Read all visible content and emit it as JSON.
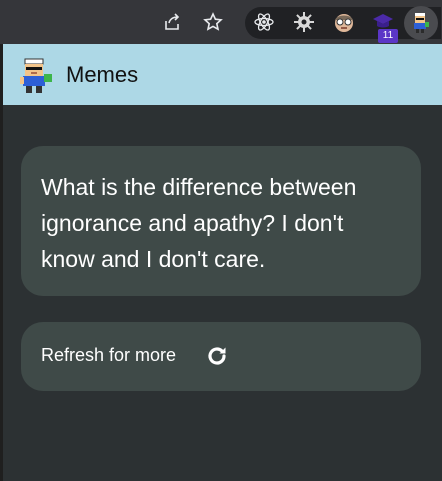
{
  "browser": {
    "icons": [
      "share-icon",
      "star-icon",
      "react-devtools-icon",
      "gear-extension-icon",
      "face-extension-icon",
      "graduation-cap-extension-icon",
      "memes-extension-icon"
    ],
    "badge_count": "11"
  },
  "popup": {
    "title": "Memes",
    "colors": {
      "header": "#add8e6",
      "card": "#3f4a48",
      "background": "#2c3133"
    },
    "joke": "What is the difference between ignorance and apathy? I don't know and I don't care.",
    "refresh_label": "Refresh for more",
    "refresh_icon": "refresh-icon"
  }
}
